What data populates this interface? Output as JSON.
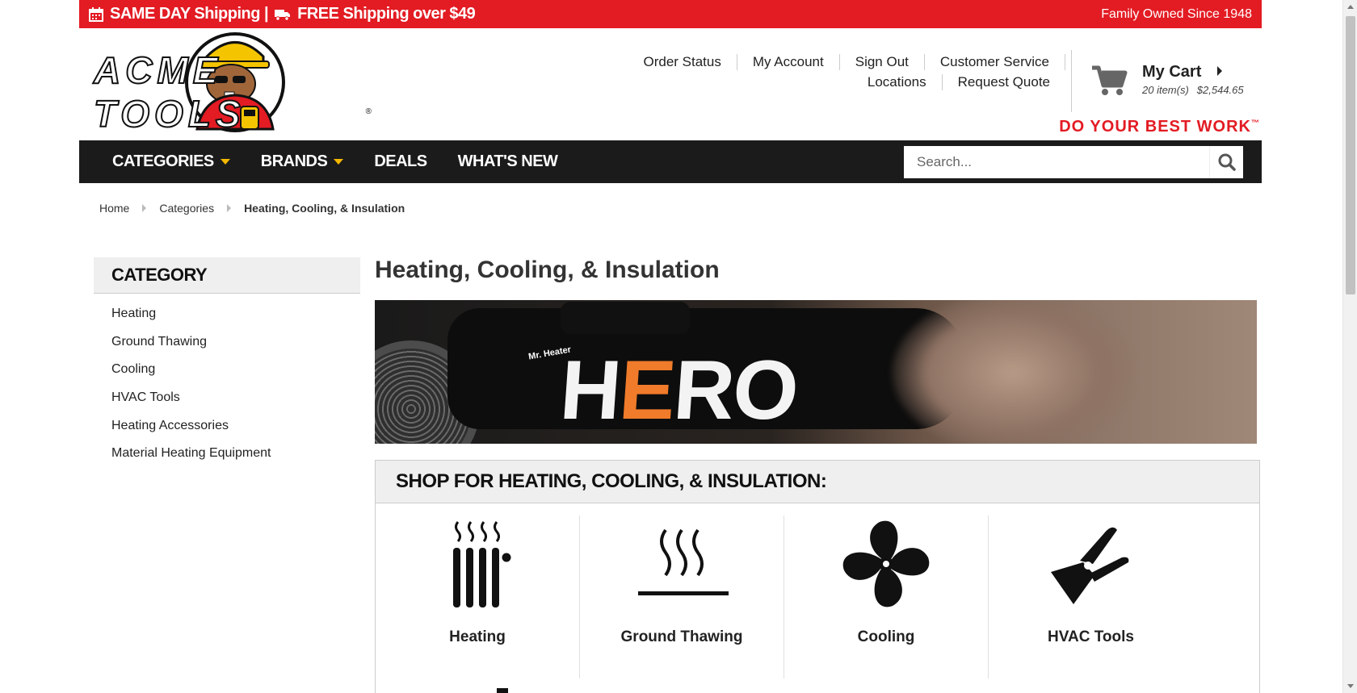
{
  "topbar": {
    "promo": "SAME DAY Shipping | ",
    "promo2": "FREE Shipping over $49",
    "family": "Family Owned Since 1948",
    "color": "#e31b23"
  },
  "logo": {
    "wordmark": "ACME TOOLS",
    "reg": "®"
  },
  "header_links": {
    "row1": [
      "Order Status",
      "My Account",
      "Sign Out",
      "Customer Service"
    ],
    "row2": [
      "Locations",
      "Request Quote"
    ]
  },
  "cart": {
    "title": "My Cart",
    "items": "20 item(s)",
    "total": "$2,544.65"
  },
  "tagline": "DO YOUR BEST WORK",
  "tagline_tm": "™",
  "nav": {
    "items": [
      "CATEGORIES",
      "BRANDS",
      "DEALS",
      "WHAT'S NEW"
    ],
    "search_placeholder": "Search..."
  },
  "breadcrumb": [
    "Home",
    "Categories",
    "Heating, Cooling, & Insulation"
  ],
  "sidebar": {
    "heading": "CATEGORY",
    "items": [
      "Heating",
      "Ground Thawing",
      "Cooling",
      "HVAC Tools",
      "Heating Accessories",
      "Material Heating Equipment"
    ]
  },
  "main": {
    "title": "Heating, Cooling, & Insulation",
    "hero": {
      "brand": "Mr. Heater",
      "word_a": "H",
      "word_b": "E",
      "word_c": "RO"
    },
    "shop_heading": "SHOP FOR HEATING, COOLING, & INSULATION:",
    "tiles": [
      {
        "label": "Heating",
        "icon": "radiator-icon"
      },
      {
        "label": "Ground Thawing",
        "icon": "heat-waves-icon"
      },
      {
        "label": "Cooling",
        "icon": "fan-icon"
      },
      {
        "label": "HVAC Tools",
        "icon": "crimper-icon"
      }
    ]
  },
  "colors": {
    "brand_red": "#e31b23",
    "nav_bg": "#1b1b1b",
    "caret": "#f5b800"
  }
}
